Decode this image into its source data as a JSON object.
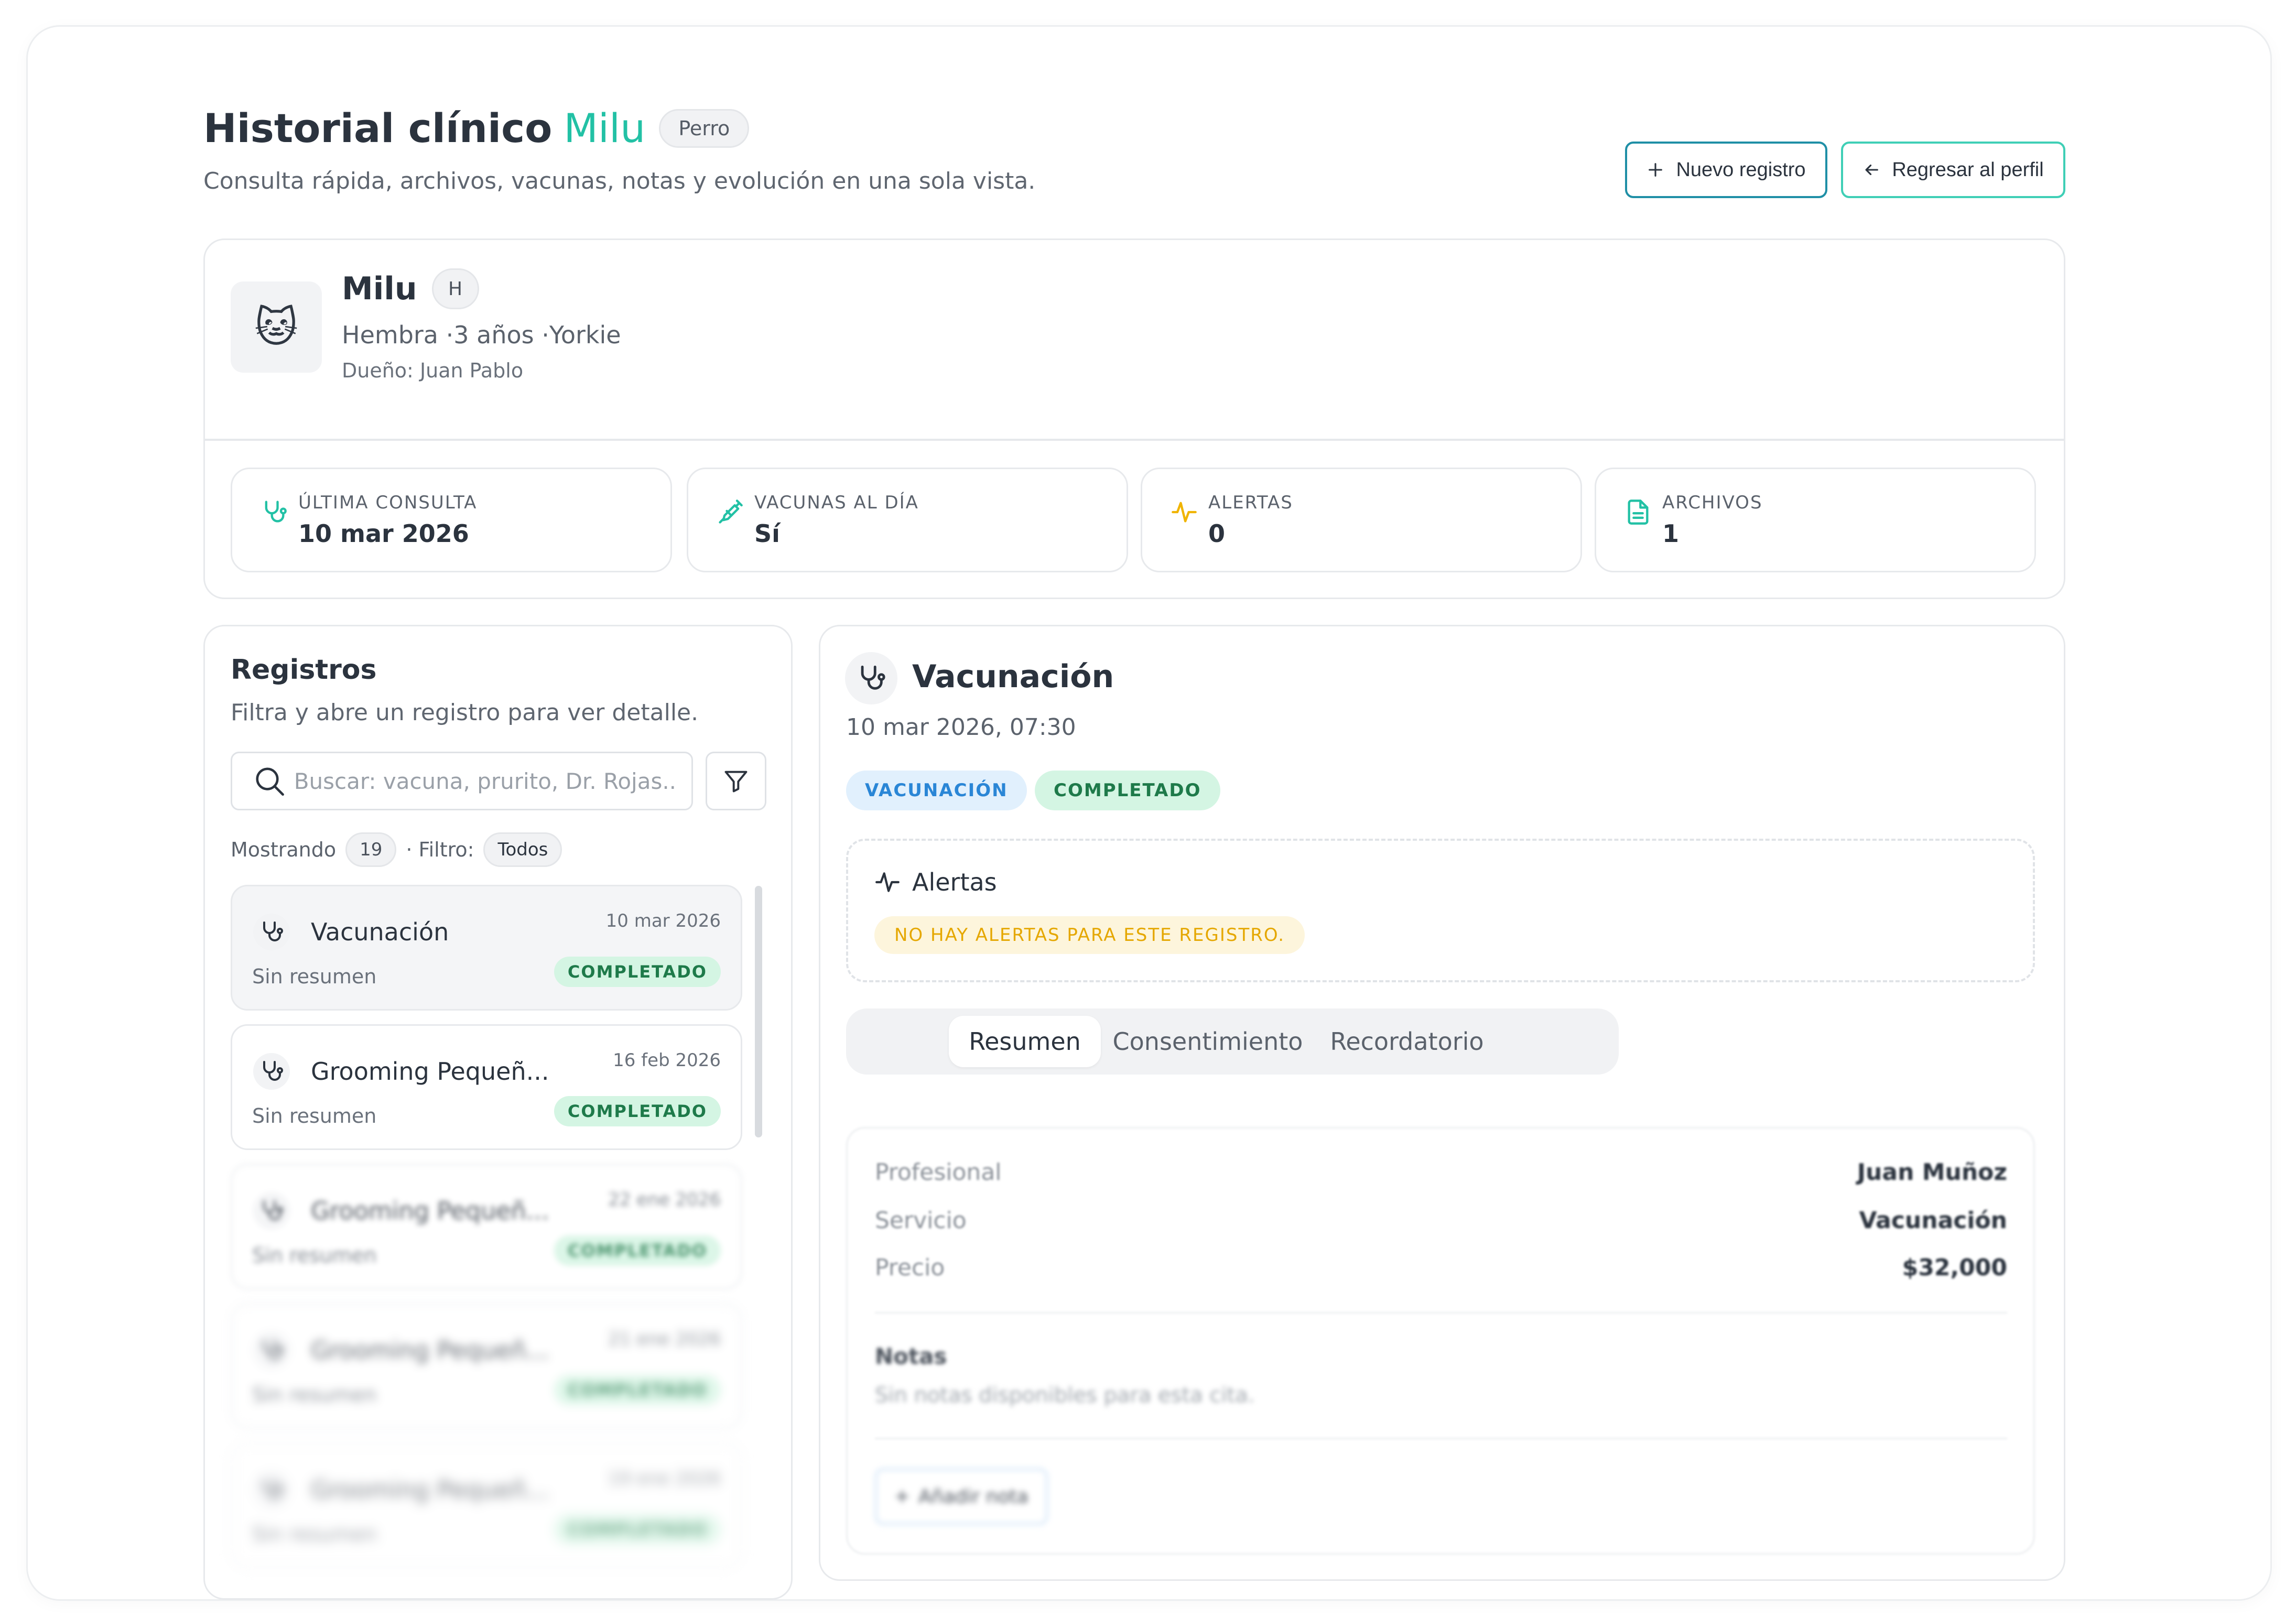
{
  "header": {
    "title": "Historial clínico",
    "pet_name": "Milu",
    "species": "Perro",
    "subtitle": "Consulta rápida, archivos, vacunas, notas y evolución en una sola vista.",
    "new_record_label": "Nuevo registro",
    "back_label": "Regresar al perfil"
  },
  "patient": {
    "name": "Milu",
    "sex_badge": "H",
    "info": "Hembra ·3 años ·Yorkie",
    "owner": "Dueño: Juan Pablo",
    "avatar": "cat-face-emoji"
  },
  "stats": [
    {
      "label": "ÚLTIMA CONSULTA",
      "value": "10 mar 2026",
      "icon": "stethoscope-icon"
    },
    {
      "label": "VACUNAS AL DÍA",
      "value": "Sí",
      "icon": "syringe-icon"
    },
    {
      "label": "ALERTAS",
      "value": "0",
      "icon": "activity-icon"
    },
    {
      "label": "ARCHIVOS",
      "value": "1",
      "icon": "file-icon"
    }
  ],
  "records_panel": {
    "title": "Registros",
    "subtitle": "Filtra y abre un registro para ver detalle.",
    "search_placeholder": "Buscar: vacuna, prurito, Dr. Rojas..",
    "showing_label": "Mostrando",
    "showing_count": "19",
    "filter_label": "· Filtro:",
    "filter_value": "Todos",
    "items": [
      {
        "name": "Vacunación",
        "date": "10 mar 2026",
        "summary": "Sin resumen",
        "status": "COMPLETADO"
      },
      {
        "name": "Grooming Pequeñ...",
        "date": "16 feb 2026",
        "summary": "Sin resumen",
        "status": "COMPLETADO"
      },
      {
        "name": "Grooming Pequeñ...",
        "date": "22 ene 2026",
        "summary": "Sin resumen",
        "status": "COMPLETADO"
      },
      {
        "name": "Grooming Pequeñ...",
        "date": "21 ene 2026",
        "summary": "Sin resumen",
        "status": "COMPLETADO"
      },
      {
        "name": "Grooming Pequeñ...",
        "date": "19 ene 2026",
        "summary": "Sin resumen",
        "status": "COMPLETADO"
      }
    ]
  },
  "detail": {
    "title": "Vacunación",
    "datetime": "10 mar 2026, 07:30",
    "type_tag": "VACUNACIÓN",
    "status_tag": "COMPLETADO",
    "alerts_title": "Alertas",
    "alerts_message": "NO HAY ALERTAS PARA ESTE REGISTRO.",
    "tabs": [
      "Resumen",
      "Consentimiento",
      "Recordatorio"
    ],
    "active_tab": "Resumen",
    "summary": [
      {
        "key": "Profesional",
        "value": "Juan Muñoz"
      },
      {
        "key": "Servicio",
        "value": "Vacunación"
      },
      {
        "key": "Precio",
        "value": "$32,000"
      }
    ],
    "notes_title": "Notas",
    "notes_text": "Sin notas disponibles para esta cita.",
    "add_note_label": "Añadir nota"
  },
  "colors": {
    "accent": "#22c1a5",
    "primary_border": "#1f8fa6",
    "success_bg": "#d4f5e3",
    "success_text": "#1e7a4a",
    "info_bg": "#e1f0fd",
    "info_text": "#2a86d6",
    "warning_bg": "#fdf5dc",
    "warning_text": "#e5a700"
  }
}
